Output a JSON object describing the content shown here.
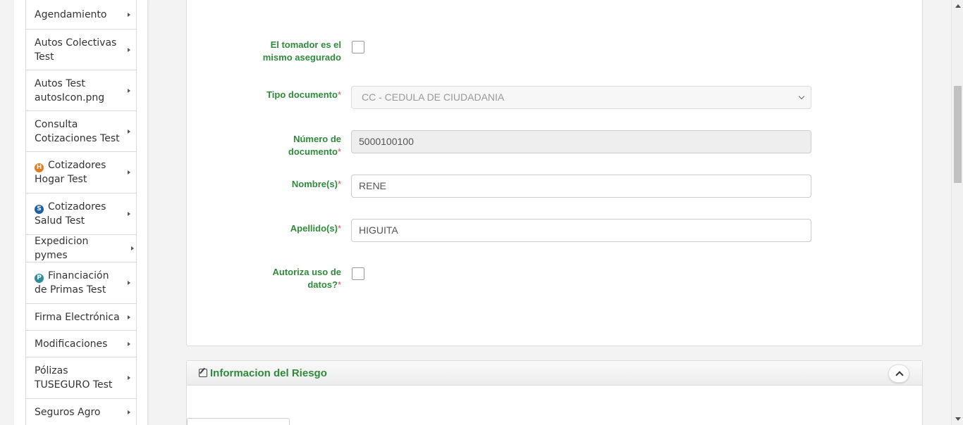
{
  "sidebar": {
    "items": [
      {
        "label": "Agendamiento",
        "icon": ""
      },
      {
        "label": "Autos Colectivas Test",
        "icon": ""
      },
      {
        "label": "Autos Test autosIcon.png",
        "icon": ""
      },
      {
        "label": "Consulta Cotizaciones Test",
        "icon": ""
      },
      {
        "label": "Cotizadores Hogar Test",
        "icon": "H"
      },
      {
        "label": "Cotizadores Salud Test",
        "icon": "S"
      },
      {
        "label": "Expedicion pymes",
        "icon": ""
      },
      {
        "label": "Financiación de Primas Test",
        "icon": "P"
      },
      {
        "label": "Firma Electrónica",
        "icon": ""
      },
      {
        "label": "Modificaciones",
        "icon": ""
      },
      {
        "label": "Pólizas TUSEGURO Test",
        "icon": ""
      },
      {
        "label": "Seguros Agro",
        "icon": ""
      }
    ]
  },
  "form": {
    "tomador_label": "El tomador es el mismo asegurado",
    "tipo_doc_label": "Tipo documento",
    "tipo_doc_value": "CC - CEDULA DE CIUDADANIA",
    "numero_doc_label": "Número de documento",
    "numero_doc_value": "5000100100",
    "nombres_label": "Nombre(s)",
    "nombres_value": "RENE",
    "apellidos_label": "Apellido(s)",
    "apellidos_value": "HIGUITA",
    "autoriza_label": "Autoriza uso de datos?",
    "required_mark": "*"
  },
  "riesgo": {
    "title": "Informacion del Riesgo"
  },
  "colors": {
    "label_green": "#2e8b3a",
    "required_red": "#d9534f"
  }
}
